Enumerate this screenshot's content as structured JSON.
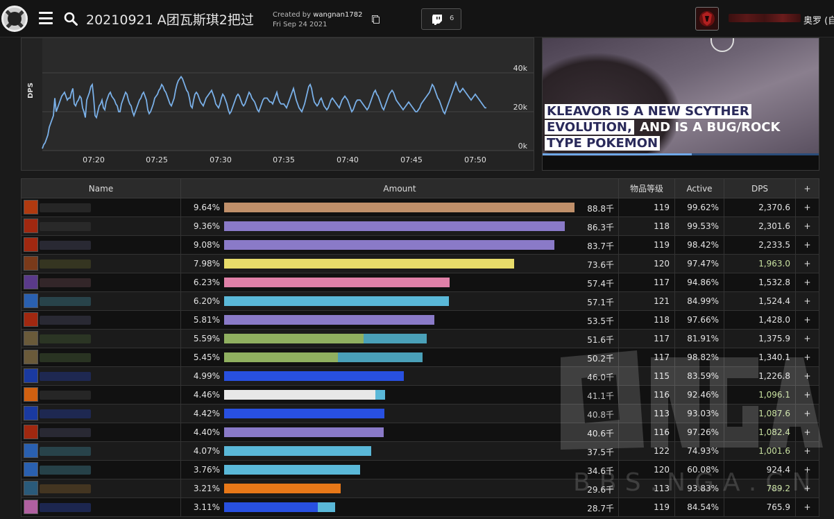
{
  "header": {
    "title": "20210921 A团瓦斯琪2把过",
    "created_by_prefix": "Created by ",
    "created_by_user": "wangnan1782",
    "created_date": "Fri Sep 24 2021",
    "twitch_count": "6",
    "realm": "奥罗 (自"
  },
  "graph": {
    "ylabel": "DPS",
    "x_ticks": [
      "07:20",
      "07:25",
      "07:30",
      "07:35",
      "07:40",
      "07:45",
      "07:50"
    ],
    "y_ticks": [
      "40k",
      "20k",
      "0k"
    ],
    "chart_data": {
      "type": "line",
      "ylabel": "DPS",
      "ylim": [
        0,
        40000
      ],
      "y_ticks": [
        "0k",
        "20k",
        "40k"
      ],
      "x_ticks": [
        "07:20",
        "07:25",
        "07:30",
        "07:35",
        "07:40",
        "07:45",
        "07:50"
      ],
      "series": [
        {
          "x": [
            0,
            2,
            4,
            6,
            8,
            10,
            12,
            14,
            16,
            18,
            20,
            22,
            24,
            26,
            28,
            30,
            32,
            34,
            36,
            38,
            40,
            42,
            44,
            46,
            48,
            50,
            52,
            54,
            56,
            58,
            60,
            62,
            64,
            66,
            68,
            70,
            72,
            74,
            76,
            78,
            80,
            82,
            84,
            86,
            88,
            90,
            92,
            94,
            96,
            98,
            100,
            102,
            104,
            106,
            108,
            110,
            112,
            114,
            116,
            118,
            120,
            122,
            124,
            126,
            128,
            130,
            132,
            134,
            136,
            138,
            140,
            142,
            144,
            146,
            148,
            150,
            152,
            154,
            156,
            158,
            160,
            162,
            164,
            166,
            168,
            170,
            172,
            174,
            176,
            178,
            180,
            182,
            184,
            186,
            188,
            190,
            192,
            194,
            196,
            198,
            200,
            202,
            204,
            206,
            208,
            210,
            212,
            214,
            216,
            218,
            220,
            222,
            224,
            226,
            228,
            230,
            232,
            234,
            236,
            238,
            240,
            242,
            244,
            246,
            248,
            250,
            252,
            254,
            256,
            258,
            260,
            262,
            264,
            266,
            268,
            270,
            272,
            274,
            276,
            278,
            280,
            282,
            284,
            286,
            288,
            290,
            292,
            294,
            296,
            298,
            300,
            302,
            304,
            306,
            308,
            310,
            312,
            314,
            316,
            318,
            320,
            322,
            324,
            326,
            328,
            330,
            332,
            334,
            336,
            338,
            340,
            342,
            344,
            346,
            348,
            350,
            352,
            354,
            356,
            358,
            360,
            362,
            364,
            366,
            368,
            370,
            372,
            374,
            376,
            378,
            380,
            382,
            384,
            386,
            388,
            390,
            392,
            394,
            396,
            398,
            400,
            402,
            404,
            406,
            408,
            410,
            412,
            414,
            416,
            418,
            420,
            422,
            424,
            426,
            428,
            430,
            432,
            434,
            436,
            438,
            440,
            442,
            444,
            446,
            448,
            450,
            452,
            454,
            456,
            458,
            460,
            462,
            464,
            466,
            468,
            470,
            472,
            474,
            476,
            478,
            480,
            482,
            484,
            486,
            488,
            490,
            492,
            494,
            496,
            498,
            500,
            502,
            504,
            506,
            508,
            510,
            512,
            514,
            516,
            518,
            520,
            522,
            524,
            526,
            528,
            530,
            532,
            534,
            536,
            538,
            540,
            542,
            544,
            546,
            548,
            550,
            552,
            554,
            556,
            558,
            560,
            562,
            564,
            566,
            568,
            570,
            572,
            574,
            576,
            578,
            580,
            582,
            584,
            586,
            588,
            590,
            592,
            594,
            596,
            598,
            600,
            602,
            604,
            606,
            608,
            610,
            612,
            614,
            616,
            618,
            620,
            622,
            624,
            626,
            628,
            630,
            632,
            634,
            636,
            638,
            640,
            642,
            644,
            646,
            648,
            650,
            652,
            654,
            656,
            658,
            660,
            662,
            664,
            666,
            668,
            670,
            672,
            674,
            676,
            678,
            680,
            682,
            684,
            686,
            688,
            690,
            692,
            694,
            696,
            698,
            700
          ],
          "values": [
            1000,
            3000,
            4000,
            6000,
            8000,
            12000,
            14000,
            16000,
            18000,
            27000,
            20000,
            22000,
            24000,
            26000,
            28000,
            29000,
            30000,
            28000,
            26000,
            27000,
            27000,
            30000,
            32000,
            24000,
            23000,
            25000,
            26000,
            28000,
            27000,
            22000,
            20000,
            17000,
            26000,
            28000,
            30000,
            33000,
            34000,
            27000,
            18000,
            17000,
            20000,
            23000,
            24000,
            26000,
            22000,
            21000,
            25000,
            27000,
            29000,
            30000,
            28000,
            27000,
            26000,
            24000,
            23000,
            20000,
            20000,
            24000,
            26000,
            28000,
            30000,
            29000,
            26000,
            24000,
            23000,
            20000,
            18000,
            20000,
            22000,
            24000,
            26000,
            27000,
            29000,
            30000,
            28000,
            26000,
            21000,
            19000,
            20000,
            22000,
            24000,
            27000,
            28000,
            29000,
            31000,
            32000,
            34000,
            33000,
            31000,
            30000,
            28000,
            26000,
            24000,
            23000,
            25000,
            27000,
            31000,
            34000,
            36000,
            37000,
            38000,
            37000,
            35000,
            33000,
            31000,
            30000,
            27000,
            23000,
            22000,
            26000,
            29000,
            30000,
            29000,
            27000,
            25000,
            24000,
            23000,
            25000,
            27000,
            28000,
            29000,
            30000,
            31000,
            29000,
            27000,
            24000,
            23000,
            22000,
            24000,
            27000,
            29000,
            28000,
            26000,
            24000,
            21000,
            19000,
            20000,
            22000,
            24000,
            26000,
            28000,
            29000,
            28000,
            26000,
            24000,
            23000,
            24000,
            26000,
            28000,
            30000,
            29000,
            27000,
            26000,
            25000,
            23000,
            21000,
            20000,
            22000,
            24000,
            26000,
            27000,
            27000,
            27000,
            26000,
            25000,
            25000,
            24000,
            26000,
            28000,
            30000,
            27000,
            25000,
            24000,
            24000,
            24000,
            23000,
            22000,
            24000,
            26000,
            28000,
            30000,
            32000,
            29000,
            26000,
            24000,
            22000,
            21000,
            20000,
            22000,
            24000,
            27000,
            30000,
            33000,
            34000,
            32000,
            28000,
            25000,
            24000,
            23000,
            24000,
            26000,
            27000,
            25000,
            23000,
            22000,
            21000,
            22000,
            24000,
            26000,
            27000,
            26000,
            25000,
            24000,
            23000,
            22000,
            24000,
            26000,
            27000,
            28000,
            27000,
            26000,
            24000,
            22000,
            20000,
            21000,
            23000,
            25000,
            26000,
            26000,
            26000,
            25000,
            24000,
            23000,
            22000,
            21000,
            22000,
            24000,
            26000,
            28000,
            30000,
            31000,
            29000,
            28000,
            26000,
            24000,
            22000,
            21000,
            23000,
            25000,
            27000,
            29000,
            30000,
            31000,
            30000,
            28000,
            26000,
            25000,
            24000,
            23000,
            22000,
            21000,
            22000,
            23000,
            24000,
            25000,
            24000,
            23000,
            22000,
            21000,
            20000,
            20000,
            21000,
            22000,
            24000,
            25000,
            26000,
            27000,
            28000,
            29000,
            30000,
            32000,
            34000,
            33000,
            31000,
            29000,
            27000,
            26000,
            24000,
            22000,
            20000,
            19000,
            21000,
            23000,
            25000,
            27000,
            29000,
            31000,
            33000,
            35000,
            33000,
            31000,
            30000,
            31000,
            32000,
            31000,
            30000,
            29000,
            28000,
            27000,
            26000,
            27000,
            28000,
            29000,
            28000,
            27000,
            26000,
            25000,
            24000,
            23000,
            22000,
            22000
          ]
        }
      ]
    }
  },
  "video": {
    "news_line1": "KLEAVOR IS A NEW SCYTHER",
    "news_line2a": "EVOLUTION,",
    "news_line2b": " AND IS A BUG/ROCK",
    "news_line3": "TYPE POKEMON"
  },
  "table": {
    "headers": {
      "name": "Name",
      "amount": "Amount",
      "ilvl": "物品等级",
      "active": "Active",
      "dps": "DPS",
      "plus": "+"
    },
    "rows": [
      {
        "pct": "9.64%",
        "amount": "88.8千",
        "ilvl": "119",
        "active": "99.62%",
        "dps": "2,370.6",
        "plus": "+",
        "fill": 0.995,
        "fill2": 0,
        "color": "#c0906a",
        "color2": "",
        "icon": "#b03a10",
        "blur": "#2a2a2a",
        "dps_color": "#e4e4e4"
      },
      {
        "pct": "9.36%",
        "amount": "86.3千",
        "ilvl": "118",
        "active": "99.53%",
        "dps": "2,301.6",
        "plus": "+",
        "fill": 0.966,
        "fill2": 0,
        "color": "#8a7ac8",
        "color2": "",
        "icon": "#a02810",
        "blur": "#2c2c2c",
        "dps_color": "#e4e4e4"
      },
      {
        "pct": "9.08%",
        "amount": "83.7千",
        "ilvl": "119",
        "active": "98.42%",
        "dps": "2,233.5",
        "plus": "+",
        "fill": 0.937,
        "fill2": 0,
        "color": "#8a7ac8",
        "color2": "",
        "icon": "#a02810",
        "blur": "#2e2e3a",
        "dps_color": "#e4e4e4"
      },
      {
        "pct": "7.98%",
        "amount": "73.6千",
        "ilvl": "120",
        "active": "97.47%",
        "dps": "1,963.0",
        "plus": "+",
        "fill": 0.822,
        "fill2": 0,
        "color": "#e8dc6a",
        "color2": "",
        "icon": "#7a3a1a",
        "blur": "#3a3a22",
        "dps_color": "#c8e0a0"
      },
      {
        "pct": "6.23%",
        "amount": "57.4千",
        "ilvl": "117",
        "active": "94.86%",
        "dps": "1,532.8",
        "plus": "+",
        "fill": 0.64,
        "fill2": 0,
        "color": "#e080a8",
        "color2": "",
        "icon": "#5a3a8a",
        "blur": "#3a2a2e",
        "dps_color": "#e4e4e4"
      },
      {
        "pct": "6.20%",
        "amount": "57.1千",
        "ilvl": "121",
        "active": "84.99%",
        "dps": "1,524.4",
        "plus": "+",
        "fill": 0.637,
        "fill2": 0,
        "color": "#5ab8d8",
        "color2": "",
        "icon": "#2a60b0",
        "blur": "#2a4a52",
        "dps_color": "#e4e4e4"
      },
      {
        "pct": "5.81%",
        "amount": "53.5千",
        "ilvl": "118",
        "active": "97.66%",
        "dps": "1,428.0",
        "plus": "+",
        "fill": 0.597,
        "fill2": 0,
        "color": "#8a7ac8",
        "color2": "",
        "icon": "#a02810",
        "blur": "#2e2e3a",
        "dps_color": "#e4e4e4"
      },
      {
        "pct": "5.59%",
        "amount": "51.6千",
        "ilvl": "117",
        "active": "81.91%",
        "dps": "1,375.9",
        "plus": "+",
        "fill": 0.395,
        "fill2": 0.18,
        "color": "#90b060",
        "color2": "#4aa0b8",
        "icon": "#6a5a3a",
        "blur": "#2e3a26",
        "dps_color": "#e4e4e4"
      },
      {
        "pct": "5.45%",
        "amount": "50.2千",
        "ilvl": "117",
        "active": "98.82%",
        "dps": "1,340.1",
        "plus": "+",
        "fill": 0.322,
        "fill2": 0.24,
        "color": "#90b060",
        "color2": "#4aa0b8",
        "icon": "#6a5a3a",
        "blur": "#2e3a26",
        "dps_color": "#e4e4e4"
      },
      {
        "pct": "4.99%",
        "amount": "46.0千",
        "ilvl": "115",
        "active": "83.59%",
        "dps": "1,226.8",
        "plus": "+",
        "fill": 0.51,
        "fill2": 0,
        "color": "#2850e0",
        "color2": "",
        "icon": "#1a3aa0",
        "blur": "#1e2a5a",
        "dps_color": "#e4e4e4"
      },
      {
        "pct": "4.46%",
        "amount": "41.1千",
        "ilvl": "116",
        "active": "92.46%",
        "dps": "1,096.1",
        "plus": "+",
        "fill": 0.43,
        "fill2": 0.028,
        "color": "#e8e8e8",
        "color2": "#5ab8d8",
        "icon": "#d06010",
        "blur": "#2a2a2a",
        "dps_color": "#c8e0a0"
      },
      {
        "pct": "4.42%",
        "amount": "40.8千",
        "ilvl": "113",
        "active": "93.03%",
        "dps": "1,087.6",
        "plus": "+",
        "fill": 0.455,
        "fill2": 0,
        "color": "#2850e0",
        "color2": "",
        "icon": "#1a3aa0",
        "blur": "#1e2a5a",
        "dps_color": "#c8e0a0"
      },
      {
        "pct": "4.40%",
        "amount": "40.6千",
        "ilvl": "116",
        "active": "97.26%",
        "dps": "1,082.4",
        "plus": "+",
        "fill": 0.453,
        "fill2": 0,
        "color": "#8a7ac8",
        "color2": "",
        "icon": "#a02810",
        "blur": "#2e2e3a",
        "dps_color": "#c8e0a0"
      },
      {
        "pct": "4.07%",
        "amount": "37.5千",
        "ilvl": "122",
        "active": "74.93%",
        "dps": "1,001.6",
        "plus": "+",
        "fill": 0.418,
        "fill2": 0,
        "color": "#5ab8d8",
        "color2": "",
        "icon": "#2a60b0",
        "blur": "#2a4a52",
        "dps_color": "#c8e0a0"
      },
      {
        "pct": "3.76%",
        "amount": "34.6千",
        "ilvl": "120",
        "active": "60.08%",
        "dps": "924.4",
        "plus": "+",
        "fill": 0.385,
        "fill2": 0,
        "color": "#5ab8d8",
        "color2": "",
        "icon": "#2a60b0",
        "blur": "#2a4a52",
        "dps_color": "#e4e4e4"
      },
      {
        "pct": "3.21%",
        "amount": "29.6千",
        "ilvl": "113",
        "active": "93.83%",
        "dps": "789.2",
        "plus": "+",
        "fill": 0.33,
        "fill2": 0,
        "color": "#e87818",
        "color2": "",
        "icon": "#2a5a7a",
        "blur": "#4a3a22",
        "dps_color": "#c8e0a0"
      },
      {
        "pct": "3.11%",
        "amount": "28.7千",
        "ilvl": "119",
        "active": "84.54%",
        "dps": "765.9",
        "plus": "+",
        "fill": 0.265,
        "fill2": 0.05,
        "color": "#2850e0",
        "color2": "#5ab8d8",
        "icon": "#b060a0",
        "blur": "#1e2a5a",
        "dps_color": "#e4e4e4"
      }
    ]
  },
  "watermark": {
    "text": "BBS.NGA.CN"
  }
}
